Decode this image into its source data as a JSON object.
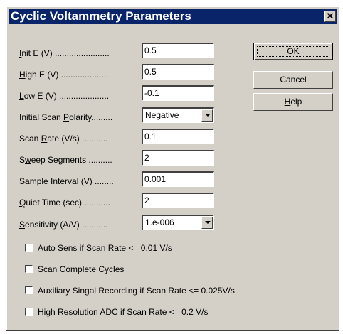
{
  "window": {
    "title": "Cyclic Voltammetry Parameters",
    "close_glyph": "✕"
  },
  "fields": [
    {
      "mnemonic": "I",
      "rest": "nit E (V) .......................",
      "value": "0.5"
    },
    {
      "mnemonic": "H",
      "rest": "igh E (V) ....................",
      "value": "0.5"
    },
    {
      "mnemonic": "L",
      "rest": "ow E (V) .....................",
      "value": "-0.1"
    }
  ],
  "polarity": {
    "pre": "Initial Scan ",
    "mnemonic": "P",
    "rest": "olarity.........",
    "value": "Negative"
  },
  "fields2": [
    {
      "pre": "Scan ",
      "mnemonic": "R",
      "rest": "ate (V/s) ...........",
      "value": "0.1"
    },
    {
      "pre": "S",
      "mnemonic": "w",
      "rest": "eep Segments ..........",
      "value": "2"
    },
    {
      "pre": "Sa",
      "mnemonic": "m",
      "rest": "ple Interval (V) ........",
      "value": "0.001"
    },
    {
      "pre": "",
      "mnemonic": "Q",
      "rest": "uiet Time (sec) ...........",
      "value": "2"
    }
  ],
  "sensitivity": {
    "pre": "",
    "mnemonic": "S",
    "rest": "ensitivity (A/V) ...........",
    "value": "1.e-006"
  },
  "checkboxes": [
    {
      "pre": "",
      "mnemonic": "A",
      "rest": "uto Sens if Scan Rate <= 0.01 V/s",
      "checked": false
    },
    {
      "pre": "Scan Complete Cycles",
      "mnemonic": "",
      "rest": "",
      "checked": false
    },
    {
      "pre": "Auxiliary Singal Recording if Scan Rate <= 0.025V/s",
      "mnemonic": "",
      "rest": "",
      "checked": false
    },
    {
      "pre": "High Resolution ADC if Scan Rate <= 0.2 V/s",
      "mnemonic": "",
      "rest": "",
      "checked": false
    }
  ],
  "buttons": {
    "ok": "OK",
    "cancel": "Cancel",
    "help_mnemonic": "H",
    "help_rest": "elp"
  },
  "colors": {
    "titlebar": "#0a246a",
    "face": "#d4d0c8"
  }
}
